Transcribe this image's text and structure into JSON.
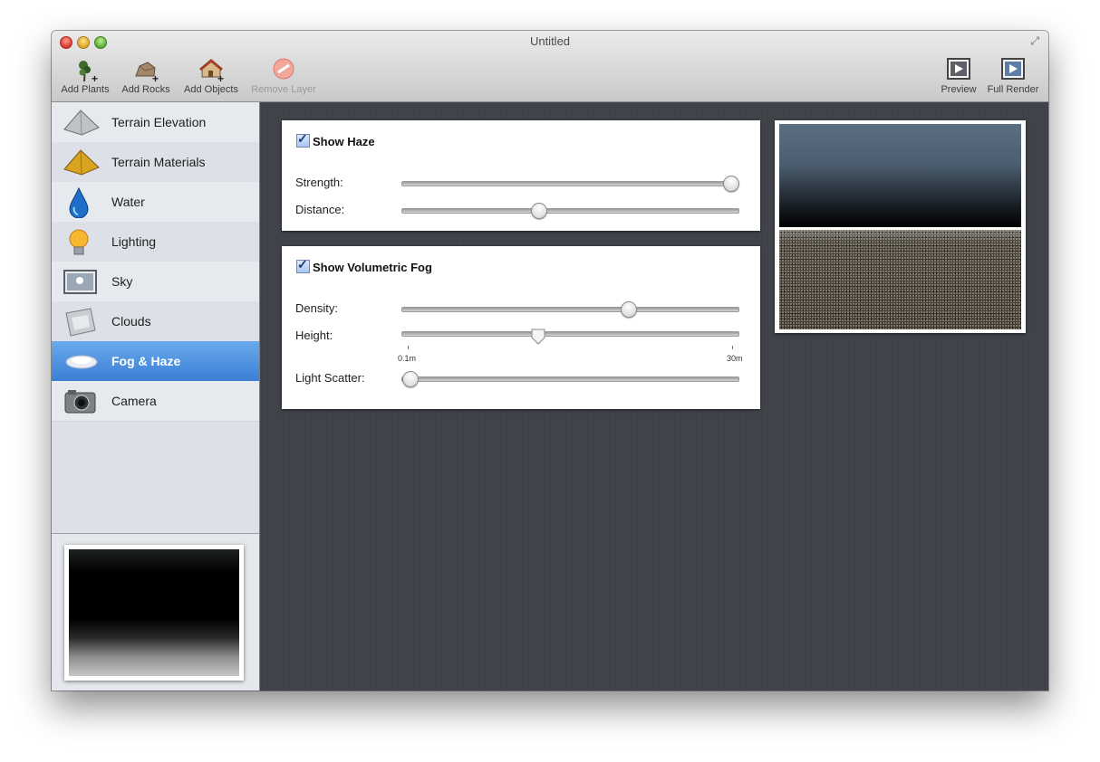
{
  "window": {
    "title": "Untitled"
  },
  "toolbar": {
    "left": [
      {
        "label": "Add Plants",
        "icon": "add-plants-icon",
        "enabled": true
      },
      {
        "label": "Add Rocks",
        "icon": "add-rocks-icon",
        "enabled": true
      },
      {
        "label": "Add Objects",
        "icon": "add-objects-icon",
        "enabled": true
      },
      {
        "label": "Remove Layer",
        "icon": "remove-layer-icon",
        "enabled": false
      }
    ],
    "right": [
      {
        "label": "Preview",
        "icon": "preview-icon"
      },
      {
        "label": "Full Render",
        "icon": "full-render-icon"
      }
    ]
  },
  "sidebar": {
    "items": [
      {
        "label": "Terrain Elevation",
        "icon": "terrain-elevation-icon"
      },
      {
        "label": "Terrain Materials",
        "icon": "terrain-materials-icon"
      },
      {
        "label": "Water",
        "icon": "water-drop-icon"
      },
      {
        "label": "Lighting",
        "icon": "light-bulb-icon"
      },
      {
        "label": "Sky",
        "icon": "sky-icon"
      },
      {
        "label": "Clouds",
        "icon": "clouds-icon"
      },
      {
        "label": "Fog & Haze",
        "icon": "fog-icon",
        "selected": true
      },
      {
        "label": "Camera",
        "icon": "camera-icon"
      }
    ]
  },
  "haze": {
    "checkbox_label": "Show Haze",
    "checked": true,
    "strength_label": "Strength:",
    "strength_value": 1.0,
    "distance_label": "Distance:",
    "distance_value": 0.4
  },
  "fog": {
    "checkbox_label": "Show Volumetric Fog",
    "checked": true,
    "density_label": "Density:",
    "density_value": 0.68,
    "height_label": "Height:",
    "height_value": 0.4,
    "height_min_label": "0.1m",
    "height_max_label": "30m",
    "scatter_label": "Light Scatter:",
    "scatter_value": 0.0
  },
  "colors": {
    "selection": "#3a7fd5",
    "background": "#3f4349"
  }
}
